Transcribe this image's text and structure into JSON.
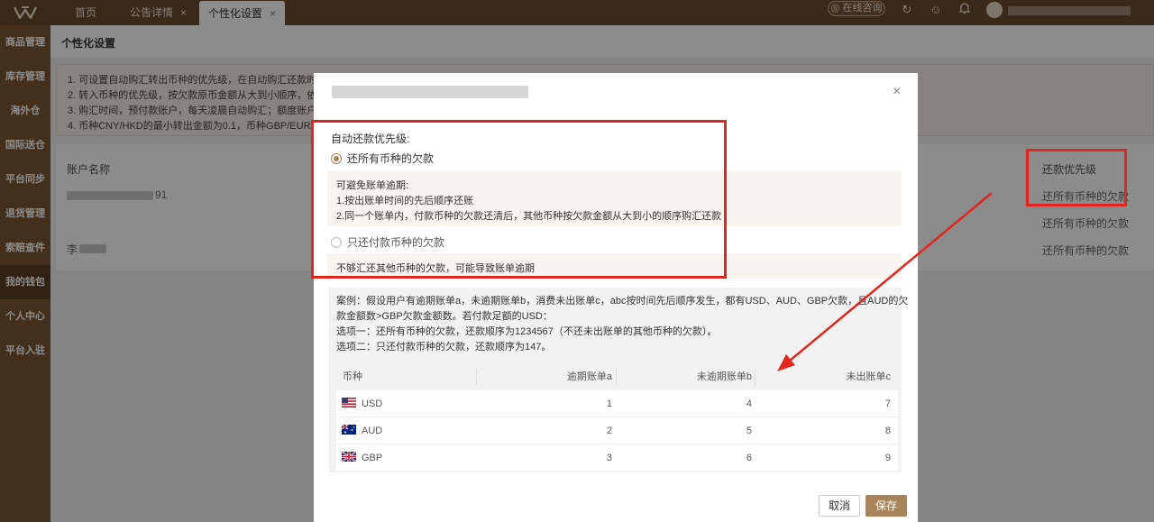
{
  "topbar": {
    "tabs": [
      {
        "label": "首页"
      },
      {
        "label": "公告详情",
        "close": "×"
      },
      {
        "label": "个性化设置",
        "close": "×"
      }
    ],
    "online_label": "在线咨询"
  },
  "sidebar": {
    "items": [
      {
        "label": "商品管理"
      },
      {
        "label": "库存管理"
      },
      {
        "label": "海外仓"
      },
      {
        "label": "国际送仓"
      },
      {
        "label": "平台同步"
      },
      {
        "label": "退货管理"
      },
      {
        "label": "索赔查件"
      },
      {
        "label": "我的钱包"
      },
      {
        "label": "个人中心"
      },
      {
        "label": "平台入驻"
      }
    ],
    "active_index": 7
  },
  "page": {
    "title": "个性化设置",
    "notice": [
      "1. 可设置自动购汇转出币种的优先级，在自动购汇还款时若",
      "2. 转入币种的优先级，按欠款原币金额从大到小顺序，依次",
      "3. 购汇时间，预付款账户，每天凌晨自动购汇；额度账户，",
      "4. 币种CNY/HKD的最小转出金额为0.1，币种GBP/EUR/AU"
    ],
    "table": {
      "col_account": "账户名称",
      "col_priority": "还款优先级",
      "rows": [
        {
          "account_suffix": "91",
          "priority": "还所有币种的欠款"
        },
        {
          "account_suffix": "",
          "priority": "还所有币种的欠款"
        },
        {
          "account_prefix": "李",
          "priority": "还所有币种的欠款"
        }
      ]
    }
  },
  "modal": {
    "section_label": "自动还款优先级:",
    "option1": {
      "label": "还所有币种的欠款",
      "checked": true,
      "desc": [
        "可避免账单逾期:",
        "1.按出账单时间的先后顺序还账",
        "2.同一个账单内，付款币种的欠款还清后，其他币种按欠款金额从大到小的顺序购汇还款"
      ]
    },
    "option2": {
      "label": "只还付款币种的欠款",
      "checked": false,
      "desc": "不够汇还其他币种的欠款，可能导致账单逾期"
    },
    "case_text": [
      "案例：假设用户有逾期账单a，未逾期账单b，消费未出账单c，abc按时间先后顺序发生，都有USD、AUD、GBP欠款，且AUD的欠",
      "款金额数>GBP欠款金额数。若付款足额的USD：",
      "选项一：还所有币种的欠款，还款顺序为1234567（不还未出账单的其他币种的欠款）。",
      "选项二：只还付款币种的欠款，还款顺序为147。"
    ],
    "case_table": {
      "headers": [
        "币种",
        "逾期账单a",
        "未逾期账单b",
        "未出账单c"
      ],
      "rows": [
        {
          "currency": "USD",
          "flag": "us-flag-icon",
          "a": "1",
          "b": "4",
          "c": "7"
        },
        {
          "currency": "AUD",
          "flag": "au-flag-icon",
          "a": "2",
          "b": "5",
          "c": "8"
        },
        {
          "currency": "GBP",
          "flag": "gb-flag-icon",
          "a": "3",
          "b": "6",
          "c": "9"
        }
      ]
    },
    "cancel_label": "取消",
    "save_label": "保存",
    "close_glyph": "×"
  },
  "colors": {
    "topbar": "#6b4a2e",
    "sidebar": "#7c5734",
    "accent": "#a8845b",
    "annotation": "#e0261f"
  }
}
